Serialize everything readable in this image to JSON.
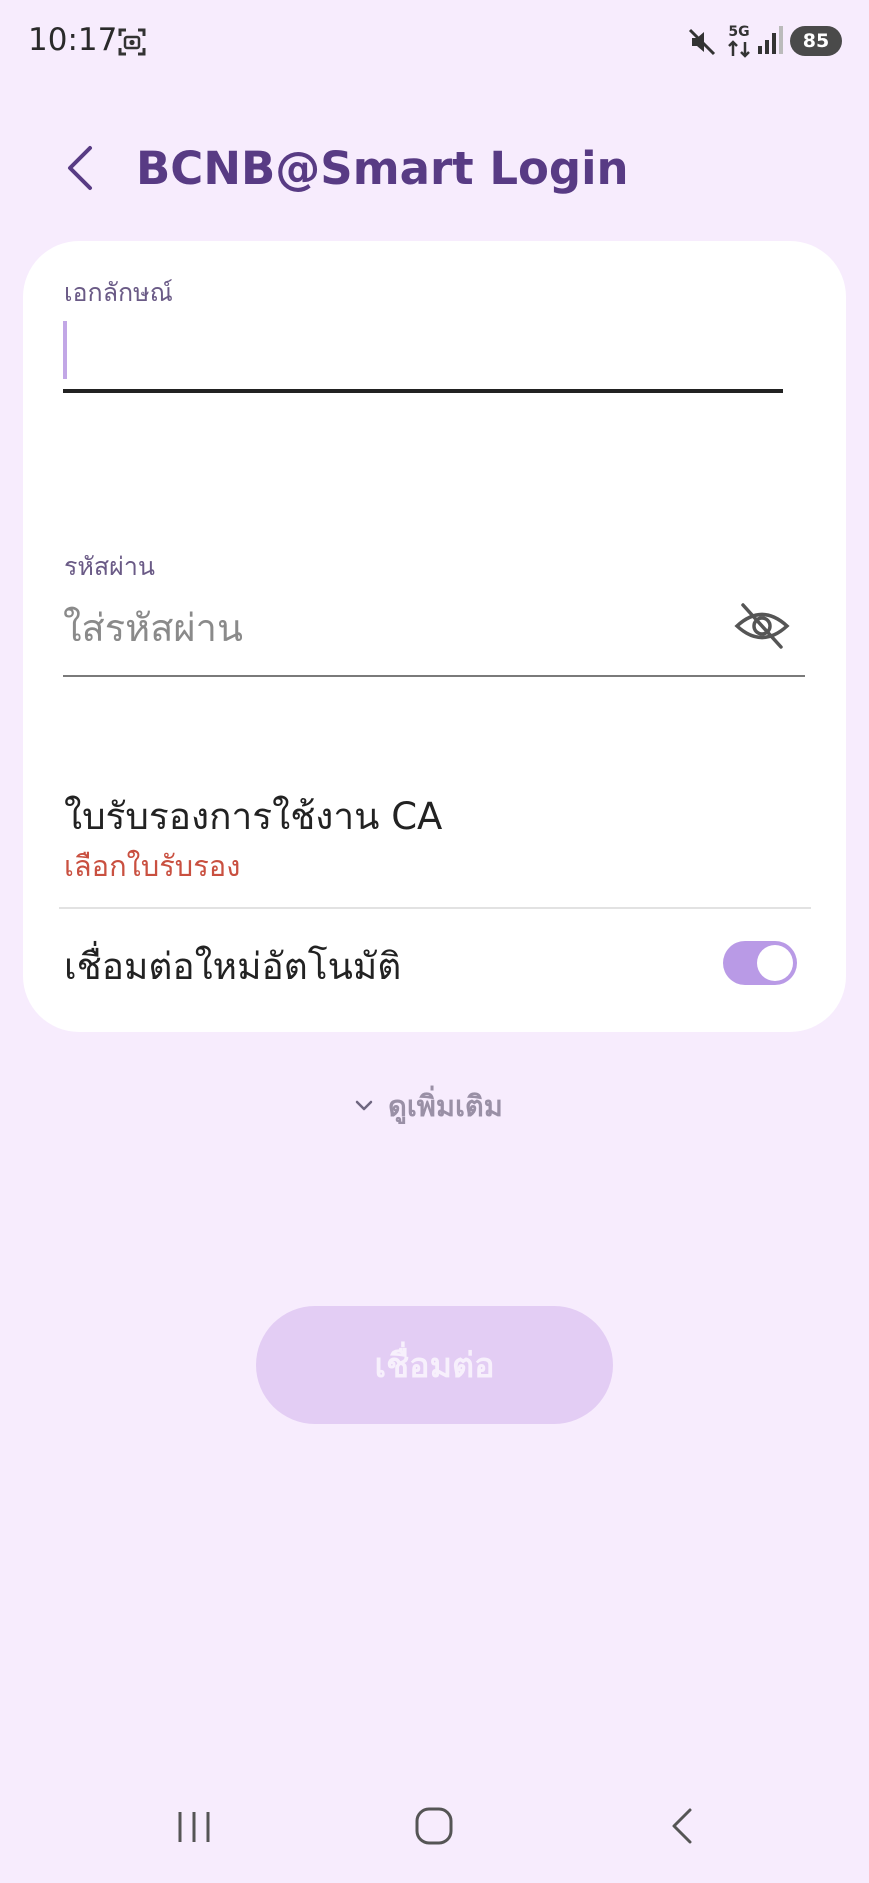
{
  "status_bar": {
    "time": "10:17",
    "network": "5G",
    "battery": "85",
    "icons": [
      "screenshot-icon",
      "mute-icon",
      "signal-icon"
    ]
  },
  "header": {
    "title": "BCNB@Smart Login",
    "back_icon": "chevron-left-icon"
  },
  "form": {
    "id_label": "เอกลักษณ์",
    "id_value": "",
    "password_label": "รหัสผ่าน",
    "password_placeholder": "ใส่รหัสผ่าน",
    "password_value": "",
    "visibility_icon": "eye-off-icon",
    "ca_title": "ใบรับรองการใช้งาน CA",
    "ca_action": "เลือกใบรับรอง",
    "auto_reconnect_label": "เชื่อมต่อใหม่อัตโนมัติ",
    "auto_reconnect_on": true
  },
  "more": {
    "label": "ดูเพิ่มเติม"
  },
  "connect": {
    "label": "เชื่อมต่อ"
  },
  "colors": {
    "background": "#f7ecfd",
    "title": "#583b84",
    "toggle_on": "#b99ae6",
    "error_text": "#c95040",
    "button_disabled": "#e3cdf4"
  },
  "nav_bar": {
    "icons": [
      "recents-icon",
      "home-icon",
      "back-icon"
    ]
  }
}
